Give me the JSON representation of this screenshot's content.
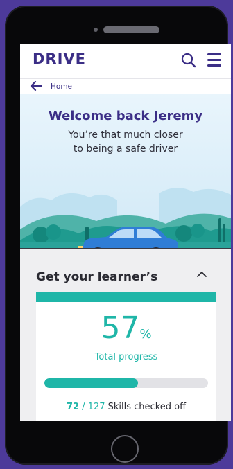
{
  "app": {
    "logo": "DRIVE"
  },
  "header": {
    "search_icon": "search-icon",
    "menu_icon": "hamburger-menu-icon"
  },
  "breadcrumb": {
    "label": "Home"
  },
  "hero": {
    "title": "Welcome back Jeremy",
    "subtitle_line1": "You’re that much closer",
    "subtitle_line2": "to being a safe driver"
  },
  "section": {
    "title": "Get your learner’s",
    "progress_percent": "57",
    "percent_symbol": "%",
    "progress_label": "Total progress",
    "progress_fraction": 0.57,
    "skills_done": "72",
    "skills_separator": "/ 127",
    "skills_label": "Skills checked off"
  },
  "colors": {
    "brand": "#3b2e86",
    "accent": "#1fb6a8",
    "background": "#4d3a9a"
  }
}
